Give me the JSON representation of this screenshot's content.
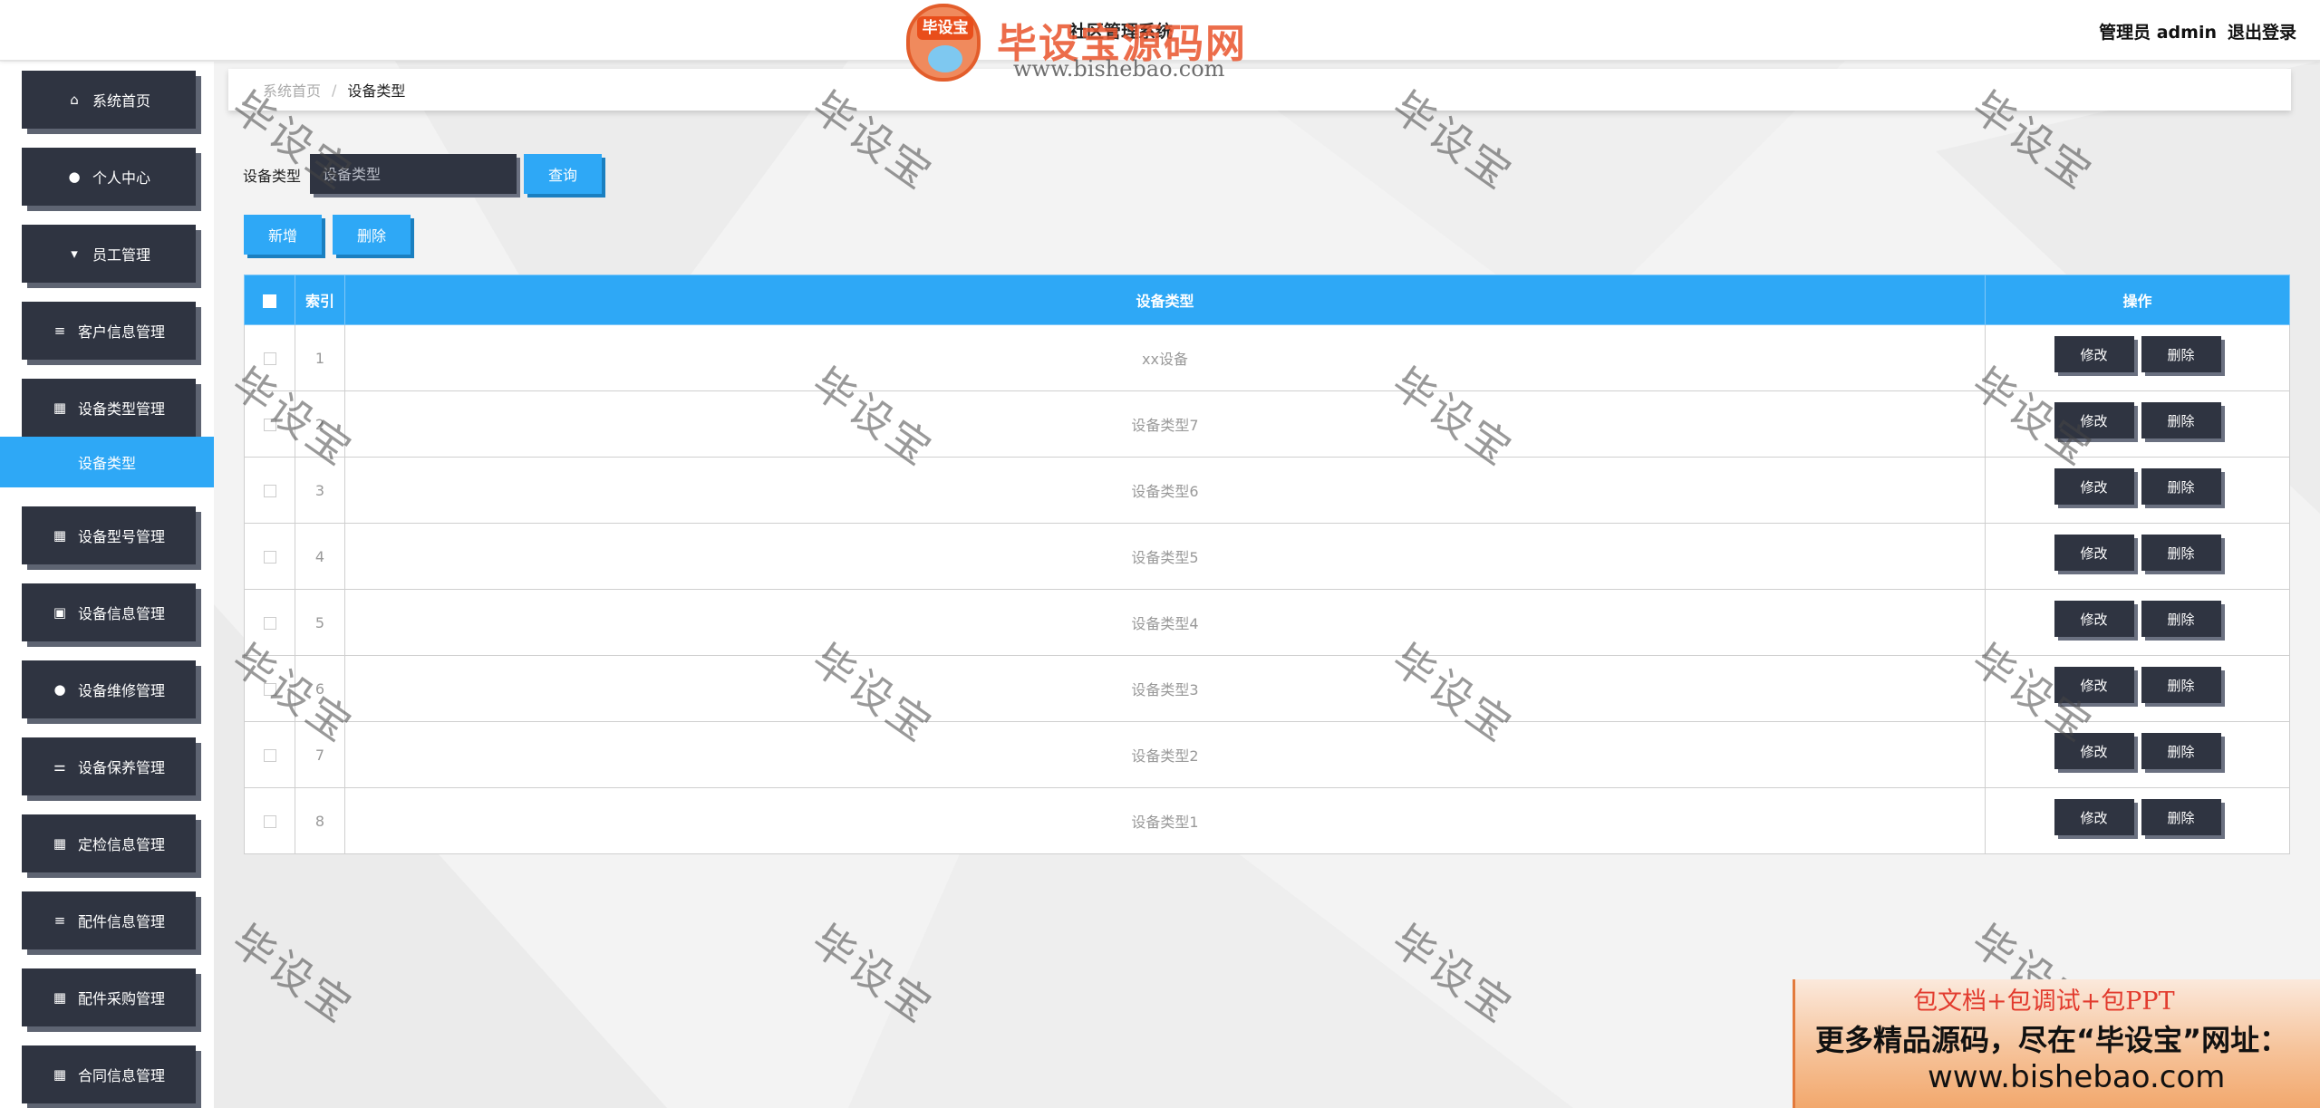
{
  "header": {
    "system_title": "社区管理系统",
    "user_label": "管理员 admin",
    "logout_label": "退出登录"
  },
  "logo": {
    "badge_text": "毕设宝",
    "name": "毕设宝源码网",
    "url": "www.bishebao.com"
  },
  "sidebar": {
    "items": [
      {
        "label": "系统首页",
        "icon": "home-icon"
      },
      {
        "label": "个人中心",
        "icon": "user-icon"
      },
      {
        "label": "员工管理",
        "icon": "staff-icon"
      },
      {
        "label": "客户信息管理",
        "icon": "list-icon"
      },
      {
        "label": "设备类型管理",
        "icon": "grid-icon"
      },
      {
        "label": "设备型号管理",
        "icon": "grid-icon"
      },
      {
        "label": "设备信息管理",
        "icon": "clipboard-icon"
      },
      {
        "label": "设备维修管理",
        "icon": "user-icon"
      },
      {
        "label": "设备保养管理",
        "icon": "sliders-icon"
      },
      {
        "label": "定检信息管理",
        "icon": "grid-icon"
      },
      {
        "label": "配件信息管理",
        "icon": "list-icon"
      },
      {
        "label": "配件采购管理",
        "icon": "grid-icon"
      },
      {
        "label": "合同信息管理",
        "icon": "grid-icon"
      }
    ],
    "active_submenu": "设备类型"
  },
  "breadcrumb": {
    "home": "系统首页",
    "separator": "/",
    "current": "设备类型"
  },
  "search": {
    "label": "设备类型",
    "placeholder": "设备类型",
    "query_label": "查询"
  },
  "actions": {
    "add_label": "新增",
    "delete_label": "删除"
  },
  "table": {
    "headers": {
      "index": "索引",
      "type": "设备类型",
      "ops": "操作"
    },
    "edit_label": "修改",
    "delete_label": "删除",
    "rows": [
      {
        "index": "1",
        "type": "xx设备"
      },
      {
        "index": "2",
        "type": "设备类型7"
      },
      {
        "index": "3",
        "type": "设备类型6"
      },
      {
        "index": "4",
        "type": "设备类型5"
      },
      {
        "index": "5",
        "type": "设备类型4"
      },
      {
        "index": "6",
        "type": "设备类型3"
      },
      {
        "index": "7",
        "type": "设备类型2"
      },
      {
        "index": "8",
        "type": "设备类型1"
      }
    ]
  },
  "watermark": "毕设宝",
  "ad": {
    "line1": "包文档+包调试+包PPT",
    "line2": "更多精品源码，尽在“毕设宝”网址：",
    "line3": "www.bishebao.com"
  },
  "colors": {
    "accent": "#2ea8f6",
    "dark": "#2f3441"
  }
}
